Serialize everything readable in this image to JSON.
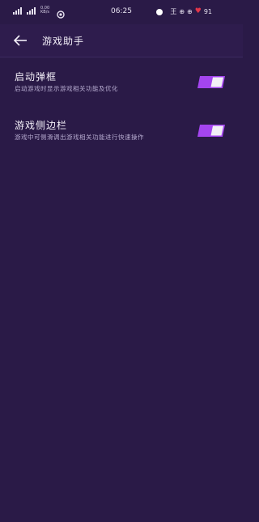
{
  "status_bar": {
    "net_speed_value": "0.00",
    "net_speed_unit": "KB/s",
    "time": "06:25",
    "extra": "王",
    "battery": "91"
  },
  "header": {
    "title": "游戏助手"
  },
  "settings": [
    {
      "title": "启动弹框",
      "description": "启动游戏时显示游戏相关功能及优化",
      "enabled": true
    },
    {
      "title": "游戏侧边栏",
      "description": "游戏中可侧滑调出游戏相关功能进行快速操作",
      "enabled": true
    }
  ],
  "colors": {
    "background": "#2a1a47",
    "header_background": "#2e1c4d",
    "toggle_on": "#a445f0",
    "toggle_knob": "#f2f0f6"
  }
}
